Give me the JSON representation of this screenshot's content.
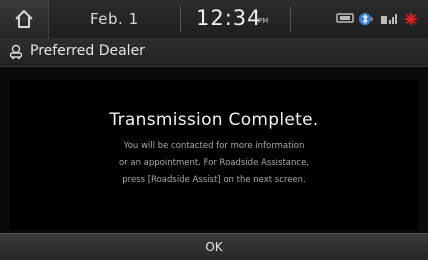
{
  "status_bar": {
    "date": "Feb. 1",
    "time": "12:34",
    "ampm": "PM",
    "icons": [
      "home-icon",
      "phone-icon",
      "bluetooth-icon",
      "signal-icon",
      "alert-icon"
    ]
  },
  "header": {
    "title": "Preferred Dealer",
    "icon": "dealer-icon"
  },
  "dialog": {
    "heading": "Transmission Complete.",
    "lines": [
      "You will be contacted for more information",
      "or an appointment. For Roadside Assistance,",
      "press [Roadside Assist] on the next screen."
    ]
  },
  "footer": {
    "ok_label": "OK"
  },
  "colors": {
    "background": "#000000",
    "bar": "#2a2a2a",
    "alert": "#e02020",
    "bluetooth": "#3a7fd5"
  }
}
